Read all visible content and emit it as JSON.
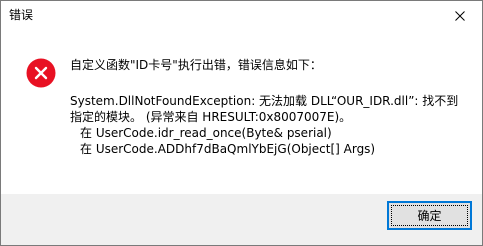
{
  "window": {
    "title": "错误"
  },
  "message": {
    "icon": "error-icon",
    "headline": "自定义函数\"ID卡号\"执行出错，错误信息如下：",
    "detail_lines": [
      "System.DllNotFoundException: 无法加载 DLL“OUR_IDR.dll”: 找不到",
      "指定的模块。 (异常来自 HRESULT:0x8007007E)。",
      "在 UserCode.idr_read_once(Byte& pserial)",
      "在 UserCode.ADDhf7dBaQmlYbEjG(Object[] Args)"
    ]
  },
  "buttons": {
    "ok_label": "确定"
  },
  "colors": {
    "error_red": "#e81123",
    "button_focus_border": "#0078d7",
    "footer_bg": "#f0f0f0"
  }
}
